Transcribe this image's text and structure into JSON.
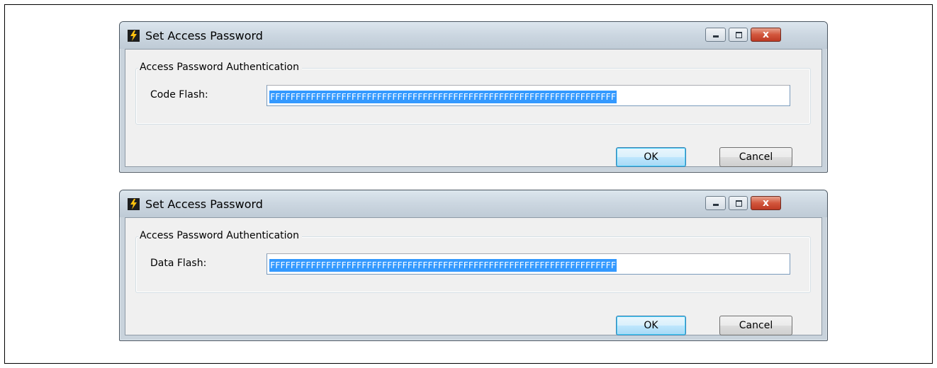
{
  "dialogs": [
    {
      "title": "Set Access Password",
      "group_label": "Access Password Authentication",
      "field_label": "Code Flash:",
      "field_value": "FFFFFFFFFFFFFFFFFFFFFFFFFFFFFFFFFFFFFFFFFFFFFFFFFFFFFFFFFFFFFFFFFFFF",
      "ok_label": "OK",
      "cancel_label": "Cancel"
    },
    {
      "title": "Set Access Password",
      "group_label": "Access Password Authentication",
      "field_label": "Data Flash:",
      "field_value": "FFFFFFFFFFFFFFFFFFFFFFFFFFFFFFFFFFFFFFFFFFFFFFFFFFFFFFFFFFFFFFFFFFFF",
      "ok_label": "OK",
      "cancel_label": "Cancel"
    }
  ],
  "window_controls": {
    "minimize_icon": "minimize-icon",
    "maximize_icon": "maximize-icon",
    "close_icon": "close-icon",
    "close_glyph": "x"
  },
  "colors": {
    "selection": "#3399ff",
    "close_button": "#c8442c",
    "titlebar": "#c9d3dc",
    "client": "#f0f0f0"
  }
}
